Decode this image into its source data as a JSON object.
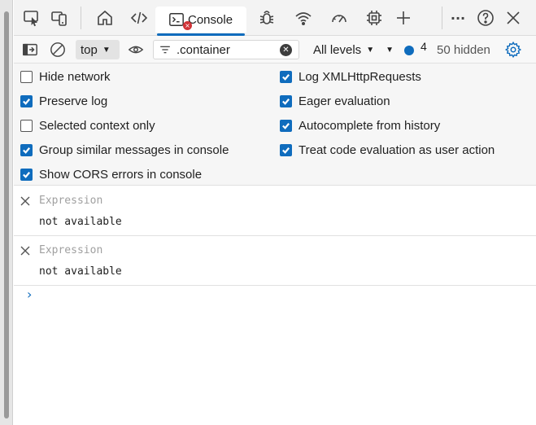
{
  "tabs": [
    {
      "name": "inspect-icon"
    },
    {
      "name": "device-emulation-icon"
    },
    {
      "name": "welcome-home-icon"
    },
    {
      "name": "elements-icon"
    },
    {
      "name": "console",
      "label": "Console",
      "error_badge": "×"
    },
    {
      "name": "sources-bug-icon"
    },
    {
      "name": "network-wifi-icon"
    },
    {
      "name": "performance-gauge-icon"
    },
    {
      "name": "memory-chip-icon"
    },
    {
      "name": "more-tools-plus-icon"
    }
  ],
  "window_controls": {
    "more": "···",
    "help": "?",
    "close": "✕"
  },
  "toolbar": {
    "context": "top",
    "filter_value": ".container",
    "levels_label": "All levels",
    "message_count": "4",
    "hidden_label": "50 hidden"
  },
  "settings": {
    "left": [
      {
        "label": "Hide network",
        "checked": false
      },
      {
        "label": "Preserve log",
        "checked": true
      },
      {
        "label": "Selected context only",
        "checked": false
      },
      {
        "label": "Group similar messages in console",
        "checked": true
      },
      {
        "label": "Show CORS errors in console",
        "checked": true
      }
    ],
    "right": [
      {
        "label": "Log XMLHttpRequests",
        "checked": true
      },
      {
        "label": "Eager evaluation",
        "checked": true
      },
      {
        "label": "Autocomplete from history",
        "checked": true
      },
      {
        "label": "Treat code evaluation as user action",
        "checked": true
      }
    ]
  },
  "expressions": [
    {
      "placeholder": "Expression",
      "value": "not available"
    },
    {
      "placeholder": "Expression",
      "value": "not available"
    }
  ],
  "prompt_glyph": "›",
  "colors": {
    "accent": "#0f6cbd",
    "error": "#d13438"
  }
}
